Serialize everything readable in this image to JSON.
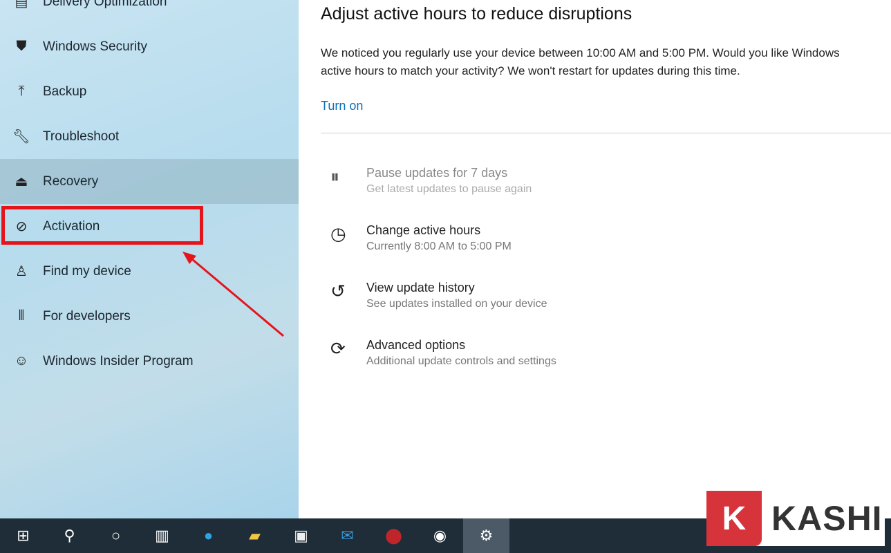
{
  "sidebar": {
    "items": [
      {
        "label": "Delivery Optimization",
        "icon": "delivery-icon"
      },
      {
        "label": "Windows Security",
        "icon": "shield-icon"
      },
      {
        "label": "Backup",
        "icon": "backup-arrow-icon"
      },
      {
        "label": "Troubleshoot",
        "icon": "wrench-icon"
      },
      {
        "label": "Recovery",
        "icon": "recovery-icon"
      },
      {
        "label": "Activation",
        "icon": "check-circle-icon"
      },
      {
        "label": "Find my device",
        "icon": "person-pin-icon"
      },
      {
        "label": "For developers",
        "icon": "developer-tools-icon"
      },
      {
        "label": "Windows Insider Program",
        "icon": "insider-cat-icon"
      }
    ]
  },
  "main": {
    "title": "Adjust active hours to reduce disruptions",
    "desc_line1": "We noticed you regularly use your device between 10:00 AM and 5:00 PM. Would you like Windows",
    "desc_line2": "active hours to match your activity? We won't restart for updates during this time.",
    "turn_on": "Turn on",
    "options": [
      {
        "title": "Pause updates for 7 days",
        "sub": "Get latest updates to pause again",
        "icon": "pause-icon"
      },
      {
        "title": "Change active hours",
        "sub": "Currently 8:00 AM to 5:00 PM",
        "icon": "active-hours-clock-icon"
      },
      {
        "title": "View update history",
        "sub": "See updates installed on your device",
        "icon": "history-icon"
      },
      {
        "title": "Advanced options",
        "sub": "Additional update controls and settings",
        "icon": "advanced-sync-gear-icon"
      }
    ]
  },
  "taskbar": [
    "start-icon",
    "search-icon",
    "cortana-icon",
    "task-view-icon",
    "edge-icon",
    "file-explorer-icon",
    "store-icon",
    "mail-icon",
    "game-app-icon",
    "obs-icon",
    "settings-gear-icon"
  ],
  "watermark": {
    "letter": "K",
    "text": "KASHI"
  },
  "colors": {
    "highlight": "#e5141b",
    "link": "#0a6fb5",
    "taskbar": "#1f2d38"
  }
}
